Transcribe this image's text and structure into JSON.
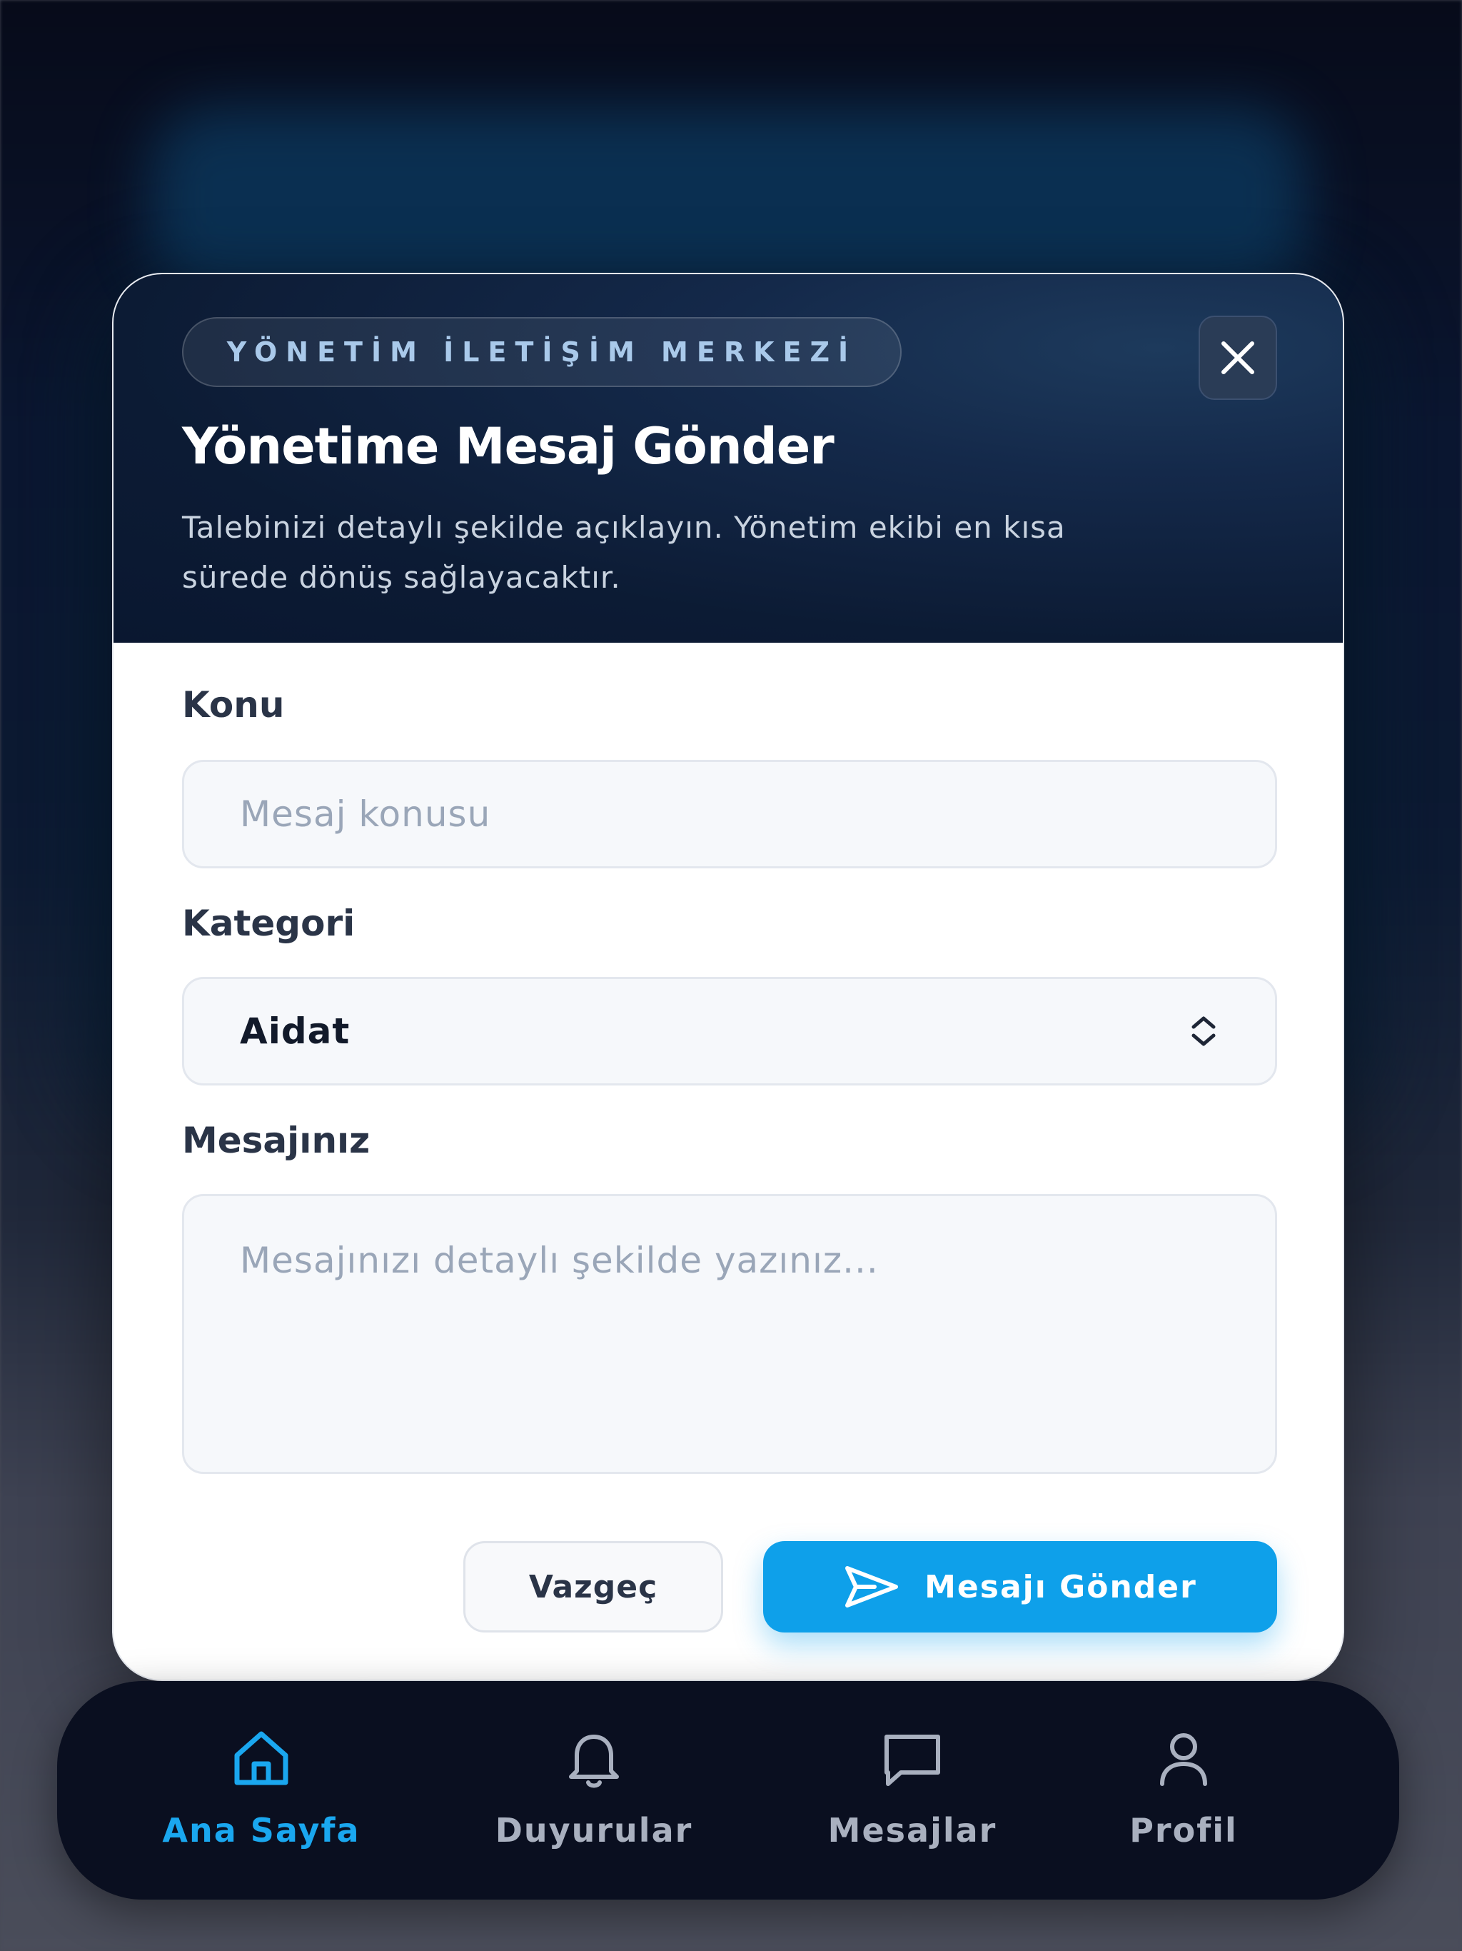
{
  "modal": {
    "badge": "YÖNETİM İLETİŞİM MERKEZİ",
    "title": "Yönetime Mesaj Gönder",
    "subtitle": "Talebinizi detaylı şekilde açıklayın. Yönetim ekibi en kısa sürede dönüş sağlayacaktır.",
    "close_icon": "close-icon"
  },
  "form": {
    "subject": {
      "label": "Konu",
      "placeholder": "Mesaj konusu",
      "value": ""
    },
    "category": {
      "label": "Kategori",
      "selected": "Aidat",
      "icon": "chevron-up-down-icon"
    },
    "message": {
      "label": "Mesajınız",
      "placeholder": "Mesajınızı detaylı şekilde yazınız...",
      "value": ""
    }
  },
  "actions": {
    "cancel_label": "Vazgeç",
    "send_label": "Mesajı Gönder",
    "send_icon": "send-icon"
  },
  "nav": {
    "items": [
      {
        "label": "Ana Sayfa",
        "icon": "home-icon",
        "active": true
      },
      {
        "label": "Duyurular",
        "icon": "bell-icon",
        "active": false
      },
      {
        "label": "Mesajlar",
        "icon": "message-icon",
        "active": false
      },
      {
        "label": "Profil",
        "icon": "user-icon",
        "active": false
      }
    ]
  },
  "colors": {
    "accent": "#0ea0ea",
    "header_bg": "#0c1b34",
    "nav_bg": "#0a0f20",
    "nav_active": "#1aa7ef"
  }
}
